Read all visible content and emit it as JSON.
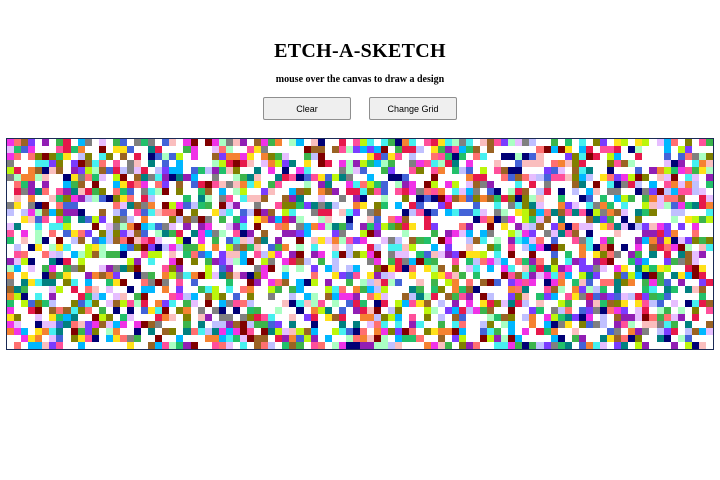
{
  "header": {
    "title": "ETCH-A-SKETCH",
    "subtitle": "mouse over the canvas to draw a design"
  },
  "controls": {
    "clear_label": "Clear",
    "change_grid_label": "Change Grid"
  },
  "canvas": {
    "grid_columns": 100,
    "grid_rows": 30,
    "palette": [
      "#e6194b",
      "#3cb44b",
      "#ffe119",
      "#4363d8",
      "#f58231",
      "#911eb4",
      "#46f0f0",
      "#f032e6",
      "#bcf60c",
      "#fabebe",
      "#008080",
      "#e6beff",
      "#9a6324",
      "#800000",
      "#aaffc3",
      "#808000",
      "#000075",
      "#808080",
      "#ff4f9a",
      "#22c06a",
      "#c0c0ff",
      "#7a3cff",
      "#00b7ff",
      "#ff7070"
    ],
    "border_color": "#1a2a55"
  }
}
